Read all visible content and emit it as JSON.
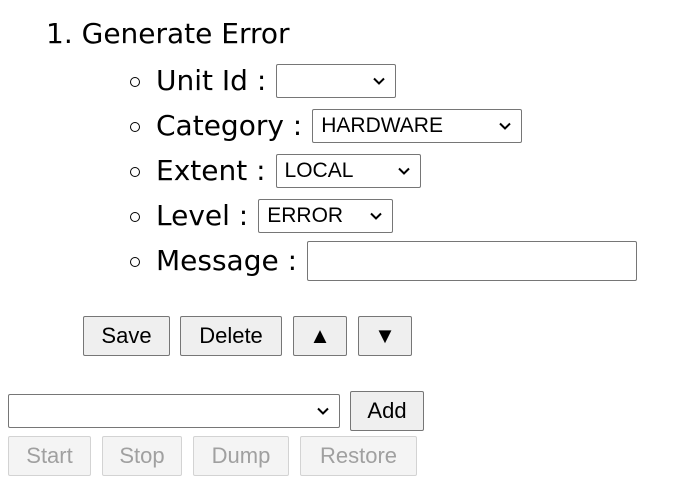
{
  "form": {
    "heading": "1. Generate Error",
    "unit_id": {
      "label": "Unit Id :",
      "value": ""
    },
    "category": {
      "label": "Category :",
      "value": "HARDWARE"
    },
    "extent": {
      "label": "Extent :",
      "value": "LOCAL"
    },
    "level": {
      "label": "Level :",
      "value": "ERROR"
    },
    "message": {
      "label": "Message :",
      "value": ""
    }
  },
  "actions": {
    "save_label": "Save",
    "delete_label": "Delete",
    "up_label": "▲",
    "down_label": "▼"
  },
  "queue": {
    "selected": "",
    "add_label": "Add"
  },
  "controls": {
    "start_label": "Start",
    "stop_label": "Stop",
    "dump_label": "Dump",
    "restore_label": "Restore"
  }
}
